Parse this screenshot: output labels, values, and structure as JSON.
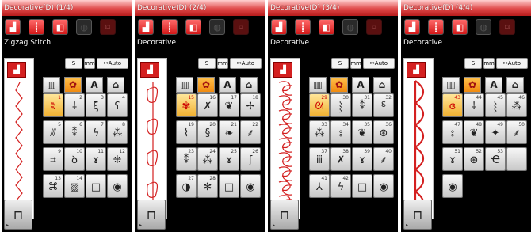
{
  "colors": {
    "title_red": "#d42020",
    "selected_cell": "#f0b030",
    "screen_bg": "#000000"
  },
  "tools": [
    {
      "icon": "bobbin-tool-icon",
      "text": "▥"
    },
    {
      "icon": "flower-tool-icon",
      "text": "✿"
    },
    {
      "icon": "letter-a-tool-icon",
      "text": "A"
    },
    {
      "icon": "shirt-tool-icon",
      "text": "⌂"
    }
  ],
  "toolbar": {
    "length_label": "S",
    "width_label": "mm",
    "auto_label": "Auto"
  },
  "screens": [
    {
      "title": "Decorative(D) (1/4)",
      "subtitle": "Zigzag Stitch",
      "preview_pattern": "zigzag",
      "selected_index": 0,
      "cells": [
        {
          "num": "1",
          "sym": "ʬ"
        },
        {
          "num": "2",
          "sym": "⸸"
        },
        {
          "num": "3",
          "sym": "ξ"
        },
        {
          "num": "4",
          "sym": "ʕ"
        },
        {
          "num": "5",
          "sym": "⫻"
        },
        {
          "num": "6",
          "sym": "⁑"
        },
        {
          "num": "7",
          "sym": "ϟ"
        },
        {
          "num": "8",
          "sym": "⁂"
        },
        {
          "num": "9",
          "sym": "⌗"
        },
        {
          "num": "10",
          "sym": "ꝺ"
        },
        {
          "num": "11",
          "sym": "ɤ"
        },
        {
          "num": "12",
          "sym": "⁜"
        },
        {
          "num": "13",
          "sym": "⌘"
        },
        {
          "num": "14",
          "sym": "▨"
        },
        {
          "num": "",
          "sym": "□"
        },
        {
          "num": "",
          "sym": "◉"
        }
      ]
    },
    {
      "title": "Decorative(D) (2/4)",
      "subtitle": "Decorative",
      "preview_pattern": "leaf",
      "selected_index": 0,
      "cells": [
        {
          "num": "15",
          "sym": "✾"
        },
        {
          "num": "16",
          "sym": "✗"
        },
        {
          "num": "17",
          "sym": "❦"
        },
        {
          "num": "18",
          "sym": "✢"
        },
        {
          "num": "19",
          "sym": "⌇"
        },
        {
          "num": "20",
          "sym": "§"
        },
        {
          "num": "21",
          "sym": "❧"
        },
        {
          "num": "22",
          "sym": "⸙"
        },
        {
          "num": "23",
          "sym": "⁑"
        },
        {
          "num": "24",
          "sym": "⁂"
        },
        {
          "num": "25",
          "sym": "ɤ"
        },
        {
          "num": "26",
          "sym": "ʃ"
        },
        {
          "num": "27",
          "sym": "◑"
        },
        {
          "num": "28",
          "sym": "✻"
        },
        {
          "num": "",
          "sym": "□"
        },
        {
          "num": "",
          "sym": "◉"
        }
      ]
    },
    {
      "title": "Decorative(D) (3/4)",
      "subtitle": "Decorative",
      "preview_pattern": "scroll",
      "selected_index": 0,
      "cells": [
        {
          "num": "29",
          "sym": "ᘛ"
        },
        {
          "num": "30",
          "sym": "⸾"
        },
        {
          "num": "31",
          "sym": "⁑"
        },
        {
          "num": "32",
          "sym": "⸹"
        },
        {
          "num": "33",
          "sym": "⁂"
        },
        {
          "num": "34",
          "sym": "⦂"
        },
        {
          "num": "35",
          "sym": "❦"
        },
        {
          "num": "36",
          "sym": "⊛"
        },
        {
          "num": "37",
          "sym": "ⅲ"
        },
        {
          "num": "38",
          "sym": "✗"
        },
        {
          "num": "39",
          "sym": "ɤ"
        },
        {
          "num": "40",
          "sym": "⸙"
        },
        {
          "num": "41",
          "sym": "⅄"
        },
        {
          "num": "42",
          "sym": "ϟ"
        },
        {
          "num": "",
          "sym": "□"
        },
        {
          "num": "",
          "sym": "◉"
        }
      ]
    },
    {
      "title": "Decorative(D) (4/4)",
      "subtitle": "Decorative",
      "preview_pattern": "scallop",
      "selected_index": 0,
      "cells": [
        {
          "num": "43",
          "sym": "ɞ"
        },
        {
          "num": "44",
          "sym": "⸸"
        },
        {
          "num": "45",
          "sym": "⸾"
        },
        {
          "num": "46",
          "sym": "⁂"
        },
        {
          "num": "47",
          "sym": "⦂"
        },
        {
          "num": "48",
          "sym": "❦"
        },
        {
          "num": "49",
          "sym": "✦"
        },
        {
          "num": "50",
          "sym": "⸙"
        },
        {
          "num": "51",
          "sym": "ɤ"
        },
        {
          "num": "52",
          "sym": "⊛"
        },
        {
          "num": "53",
          "sym": "Ҽ"
        },
        {
          "num": "",
          "sym": ""
        },
        {
          "num": "",
          "sym": "◉"
        }
      ]
    }
  ]
}
